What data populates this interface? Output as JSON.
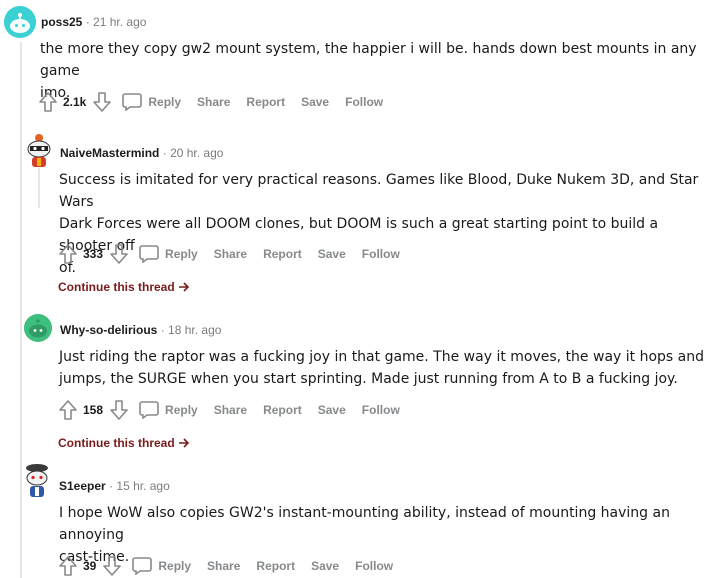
{
  "comments": [
    {
      "author": "poss25",
      "dot": "·",
      "time": "21 hr. ago",
      "body_lines": [
        "the more they copy gw2 mount system, the happier i will be. hands down best mounts in any game",
        "imo."
      ],
      "score": "2.1k",
      "avatar_color": "#3bd0d4"
    },
    {
      "author": "NaiveMastermind",
      "dot": "·",
      "time": "20 hr. ago",
      "body_lines": [
        "Success is imitated for very practical reasons. Games like Blood, Duke Nukem 3D, and Star Wars",
        "Dark Forces were all DOOM clones, but DOOM is such a great starting point to build a shooter off",
        "of."
      ],
      "score": "333",
      "continue": "Continue this thread"
    },
    {
      "author": "Why-so-delirious",
      "dot": "·",
      "time": "18 hr. ago",
      "body_lines": [
        "Just riding the raptor was a fucking joy in that game. The way it moves, the way it hops and",
        "jumps, the SURGE when you start sprinting. Made just running from A to B a fucking joy."
      ],
      "score": "158",
      "continue": "Continue this thread",
      "avatar_color": "#3fbf7f"
    },
    {
      "author": "S1eeper",
      "dot": "·",
      "time": "15 hr. ago",
      "body_lines": [
        "I hope WoW also copies GW2's instant-mounting ability, instead of mounting having an annoying",
        "cast-time."
      ],
      "score": "39"
    }
  ],
  "actions": {
    "reply": "Reply",
    "share": "Share",
    "report": "Report",
    "save": "Save",
    "follow": "Follow"
  },
  "icons": {
    "upvote": "upvote-arrow-icon",
    "downvote": "downvote-arrow-icon",
    "reply": "speech-bubble-icon",
    "continue": "arrow-right-icon"
  },
  "colors": {
    "continue_link": "#7a1b1b",
    "meta_gray": "#7c7c7c",
    "action_gray": "#878a8c"
  }
}
